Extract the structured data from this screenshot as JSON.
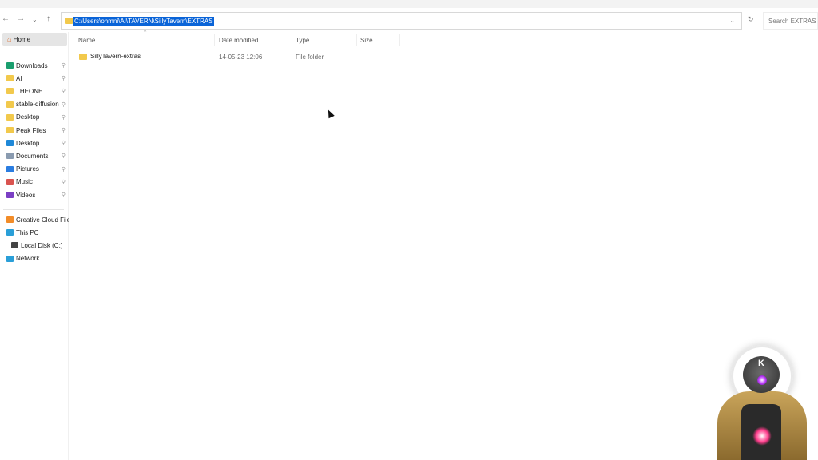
{
  "address": {
    "path": "C:\\Users\\ohmni\\AI\\TAVERN\\SillyTavern\\EXTRAS"
  },
  "search": {
    "placeholder": "Search EXTRAS"
  },
  "sidebar": {
    "home": "Home",
    "quick": [
      {
        "label": "Downloads",
        "color": "#1a9e6e"
      },
      {
        "label": "AI",
        "color": "#f2c94c"
      },
      {
        "label": "THEONE",
        "color": "#f2c94c"
      },
      {
        "label": "stable-diffusion",
        "color": "#f2c94c"
      },
      {
        "label": "Desktop",
        "color": "#f2c94c"
      },
      {
        "label": "Peak Files",
        "color": "#f2c94c"
      },
      {
        "label": "Desktop",
        "color": "#1e88d8"
      },
      {
        "label": "Documents",
        "color": "#8a9bb0"
      },
      {
        "label": "Pictures",
        "color": "#2a7de1"
      },
      {
        "label": "Music",
        "color": "#d9534f"
      },
      {
        "label": "Videos",
        "color": "#7b3fc4"
      }
    ],
    "other": [
      {
        "label": "Creative Cloud Files",
        "color": "#f28c28"
      },
      {
        "label": "This PC",
        "color": "#2a9fd8"
      },
      {
        "label": "Local Disk (C:)",
        "color": "#444"
      },
      {
        "label": "Network",
        "color": "#2a9fd8"
      }
    ]
  },
  "columns": {
    "name": "Name",
    "date": "Date modified",
    "type": "Type",
    "size": "Size"
  },
  "files": [
    {
      "name": "SillyTavern-extras",
      "date": "14-05-23 12:06",
      "type": "File folder",
      "size": ""
    }
  ],
  "overlay": {
    "badge": "K"
  }
}
